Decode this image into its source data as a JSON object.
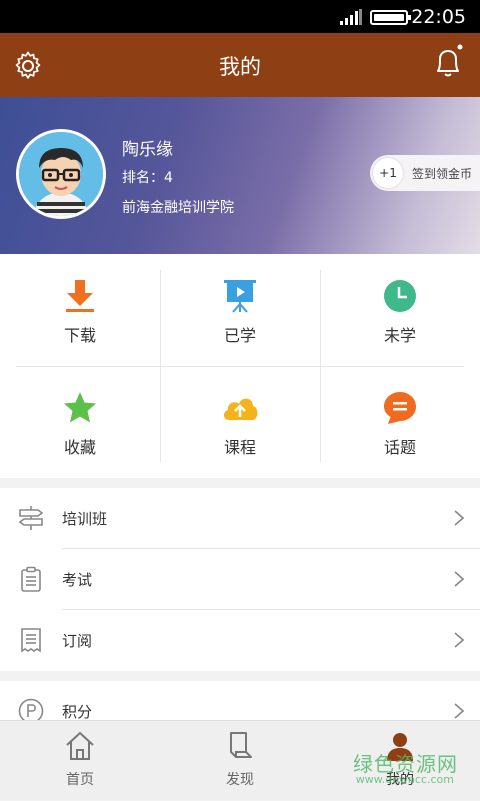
{
  "status_bar": {
    "time": "22:05"
  },
  "header": {
    "title": "我的"
  },
  "profile": {
    "name": "陶乐缘",
    "rank": "排名：4",
    "school": "前海金融培训学院",
    "signin_badge": "+1",
    "signin_label": "签到领金币"
  },
  "grid": [
    {
      "label": "下载",
      "icon": "download-icon",
      "color": "#f07020"
    },
    {
      "label": "已学",
      "icon": "presentation-icon",
      "color": "#3aa0e0"
    },
    {
      "label": "未学",
      "icon": "clock-icon",
      "color": "#3fb88a"
    },
    {
      "label": "收藏",
      "icon": "star-icon",
      "color": "#5cc04a"
    },
    {
      "label": "课程",
      "icon": "cloud-upload-icon",
      "color": "#f6b21a"
    },
    {
      "label": "话题",
      "icon": "chat-icon",
      "color": "#f06a20"
    }
  ],
  "menu": [
    {
      "label": "培训班",
      "icon": "signpost-icon"
    },
    {
      "label": "考试",
      "icon": "clipboard-icon"
    },
    {
      "label": "订阅",
      "icon": "receipt-icon"
    },
    {
      "label": "积分",
      "icon": "points-icon"
    }
  ],
  "tabs": [
    {
      "label": "首页",
      "icon": "home-icon"
    },
    {
      "label": "发现",
      "icon": "discover-icon"
    },
    {
      "label": "我的",
      "icon": "user-icon"
    }
  ],
  "watermark": {
    "text": "绿色资源网",
    "sub": "www.downcc.com"
  },
  "colors": {
    "header": "#8f3f14",
    "accent": "#f07020"
  }
}
